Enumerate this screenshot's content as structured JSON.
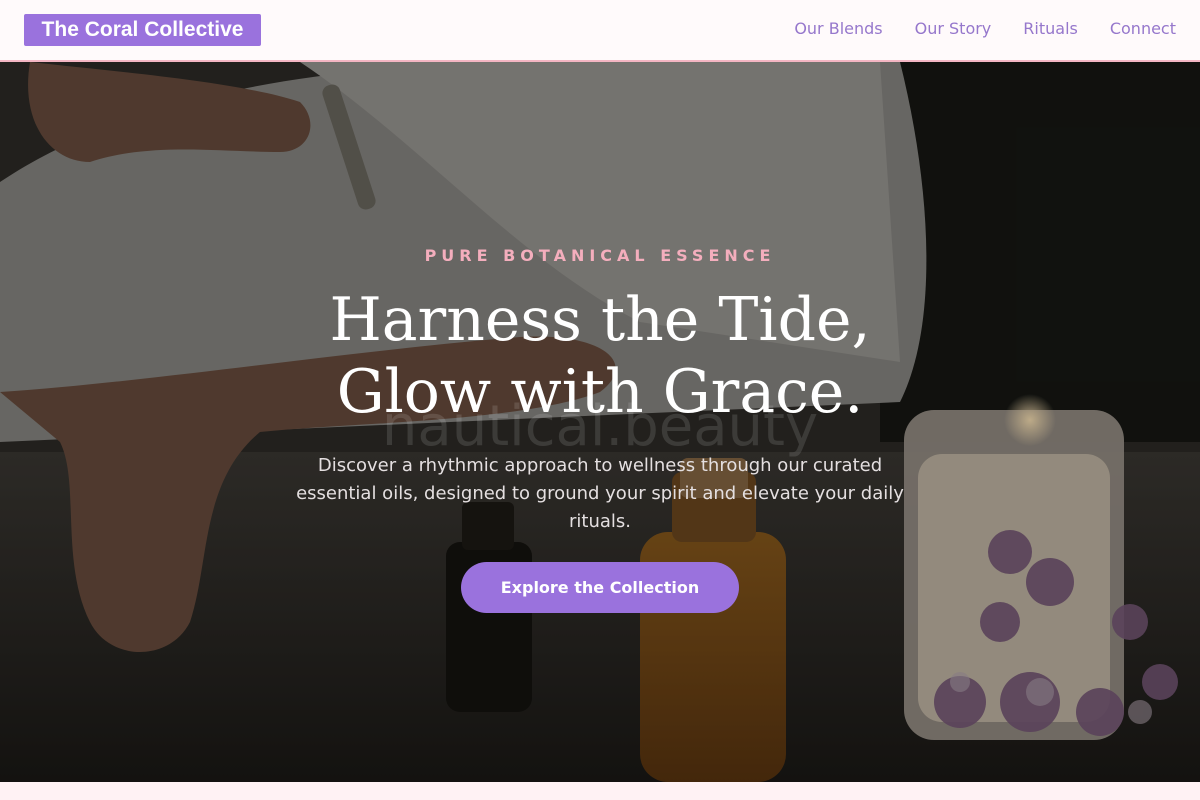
{
  "header": {
    "brand": "The Coral Collective",
    "nav": [
      "Our Blends",
      "Our Story",
      "Rituals",
      "Connect"
    ]
  },
  "hero": {
    "eyebrow": "PURE BOTANICAL ESSENCE",
    "headline": "Harness the Tide,\nGlow with Grace.",
    "watermark": "nautical.beauty",
    "lede": "Discover a rhythmic approach to wellness through our curated essential oils, designed to ground your spirit and elevate your daily rituals.",
    "cta": "Explore the Collection",
    "background_icon": "essential-oils-candle-photo-icon"
  },
  "colors": {
    "accent": "#9a72dd",
    "nav_text": "#9677cc",
    "eyebrow": "#f4aebd",
    "border": "#f4b6c3",
    "page_bg": "#fff2f4"
  }
}
